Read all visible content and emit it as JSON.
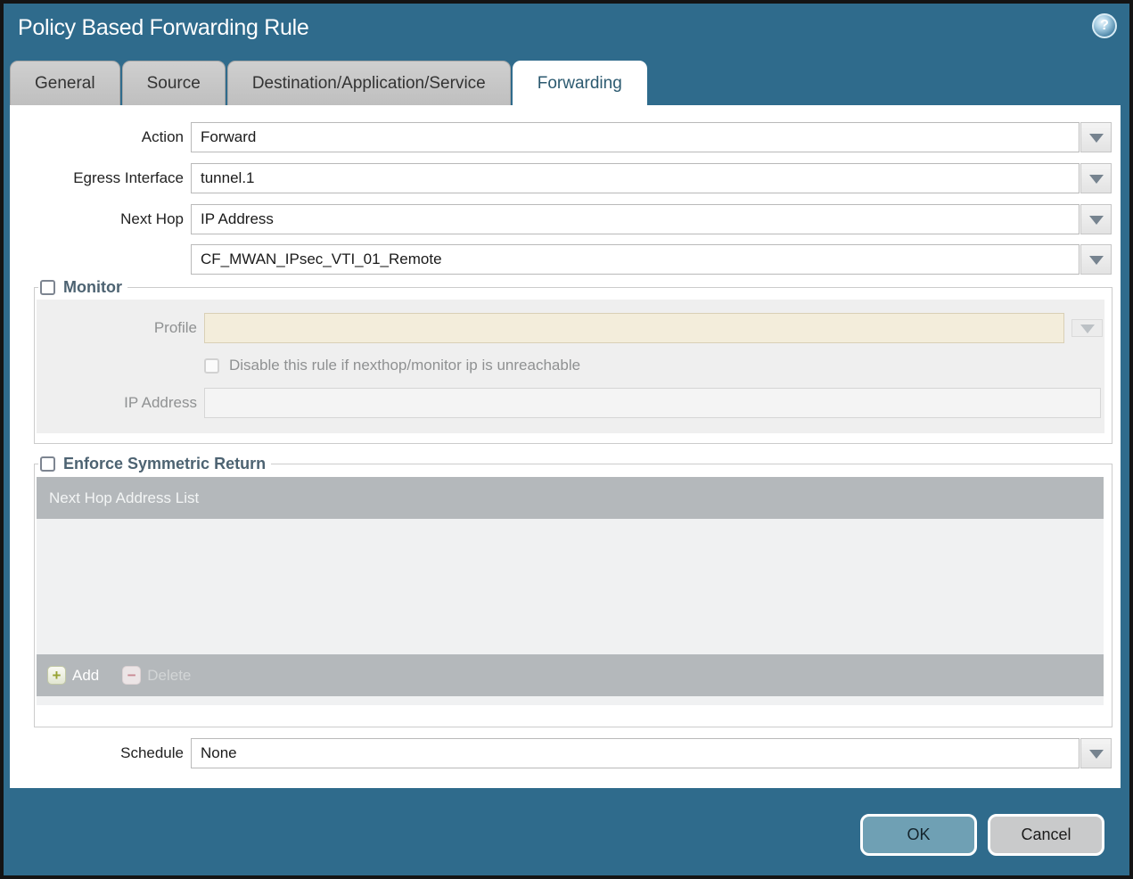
{
  "window": {
    "title": "Policy Based Forwarding Rule",
    "help_icon": "?"
  },
  "tabs": [
    {
      "label": "General",
      "active": false
    },
    {
      "label": "Source",
      "active": false
    },
    {
      "label": "Destination/Application/Service",
      "active": false
    },
    {
      "label": "Forwarding",
      "active": true
    }
  ],
  "form": {
    "action": {
      "label": "Action",
      "value": "Forward"
    },
    "egress_interface": {
      "label": "Egress Interface",
      "value": "tunnel.1"
    },
    "next_hop": {
      "label": "Next Hop",
      "value": "IP Address"
    },
    "next_hop_address": {
      "value": "CF_MWAN_IPsec_VTI_01_Remote"
    },
    "schedule": {
      "label": "Schedule",
      "value": "None"
    }
  },
  "monitor": {
    "title": "Monitor",
    "checked": false,
    "profile": {
      "label": "Profile",
      "value": ""
    },
    "disable_rule": {
      "label": "Disable this rule if nexthop/monitor ip is unreachable",
      "checked": false
    },
    "ip_address": {
      "label": "IP Address",
      "value": ""
    }
  },
  "enforce_symmetric_return": {
    "title": "Enforce Symmetric Return",
    "checked": false,
    "table": {
      "header": "Next Hop Address List",
      "rows": []
    },
    "buttons": {
      "add": "Add",
      "delete": "Delete"
    }
  },
  "footer": {
    "ok": "OK",
    "cancel": "Cancel"
  },
  "colors": {
    "titlebar": "#2f6b8c",
    "ok_button": "#6fa0b4",
    "cancel_button": "#c9cacb",
    "profile_disabled_bg": "#f3eddb",
    "table_header": "#b4b8bb",
    "section_label": "#4d6372",
    "tab_inactive": "#c6c6c6",
    "active_tab_text": "#2c5a70"
  }
}
